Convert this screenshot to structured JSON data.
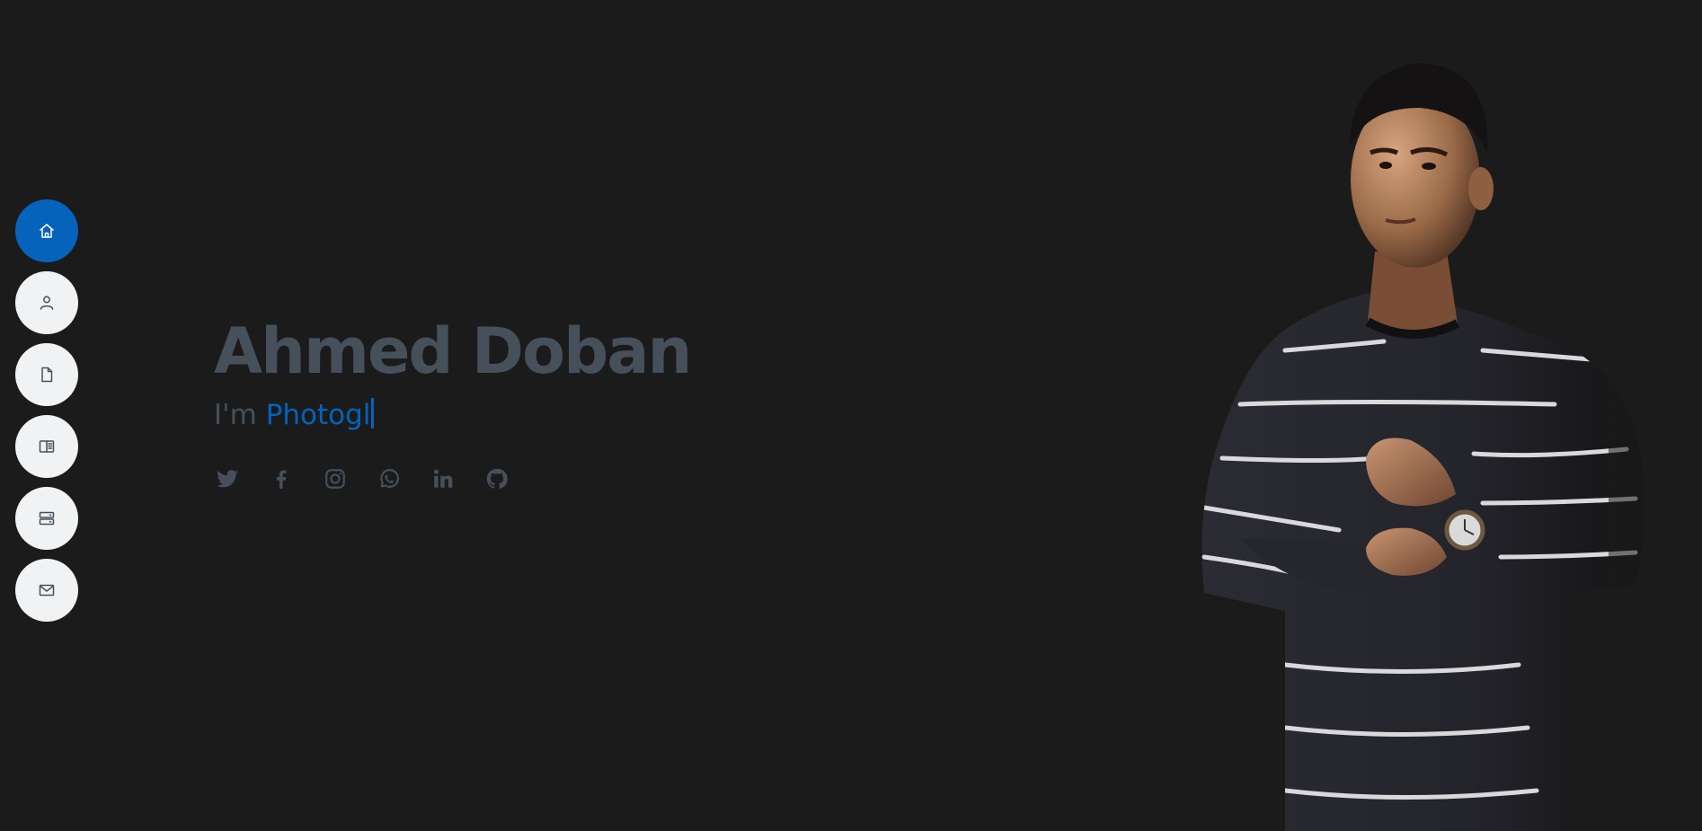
{
  "hero": {
    "name": "Ahmed Doban",
    "tagline_prefix": "I'm ",
    "tagline_typed": "Photogl"
  },
  "nav": {
    "items": [
      {
        "icon": "home-icon",
        "active": true
      },
      {
        "icon": "person-icon",
        "active": false
      },
      {
        "icon": "file-icon",
        "active": false
      },
      {
        "icon": "book-half-icon",
        "active": false
      },
      {
        "icon": "server-icon",
        "active": false
      },
      {
        "icon": "envelope-icon",
        "active": false
      }
    ]
  },
  "social": {
    "items": [
      {
        "icon": "twitter-icon"
      },
      {
        "icon": "facebook-icon"
      },
      {
        "icon": "instagram-icon"
      },
      {
        "icon": "whatsapp-icon"
      },
      {
        "icon": "linkedin-icon"
      },
      {
        "icon": "github-icon"
      }
    ]
  },
  "colors": {
    "background": "#1b1b1c",
    "accent": "#0563bb",
    "text": "#45505b",
    "nav_button": "#f1f2f3"
  }
}
